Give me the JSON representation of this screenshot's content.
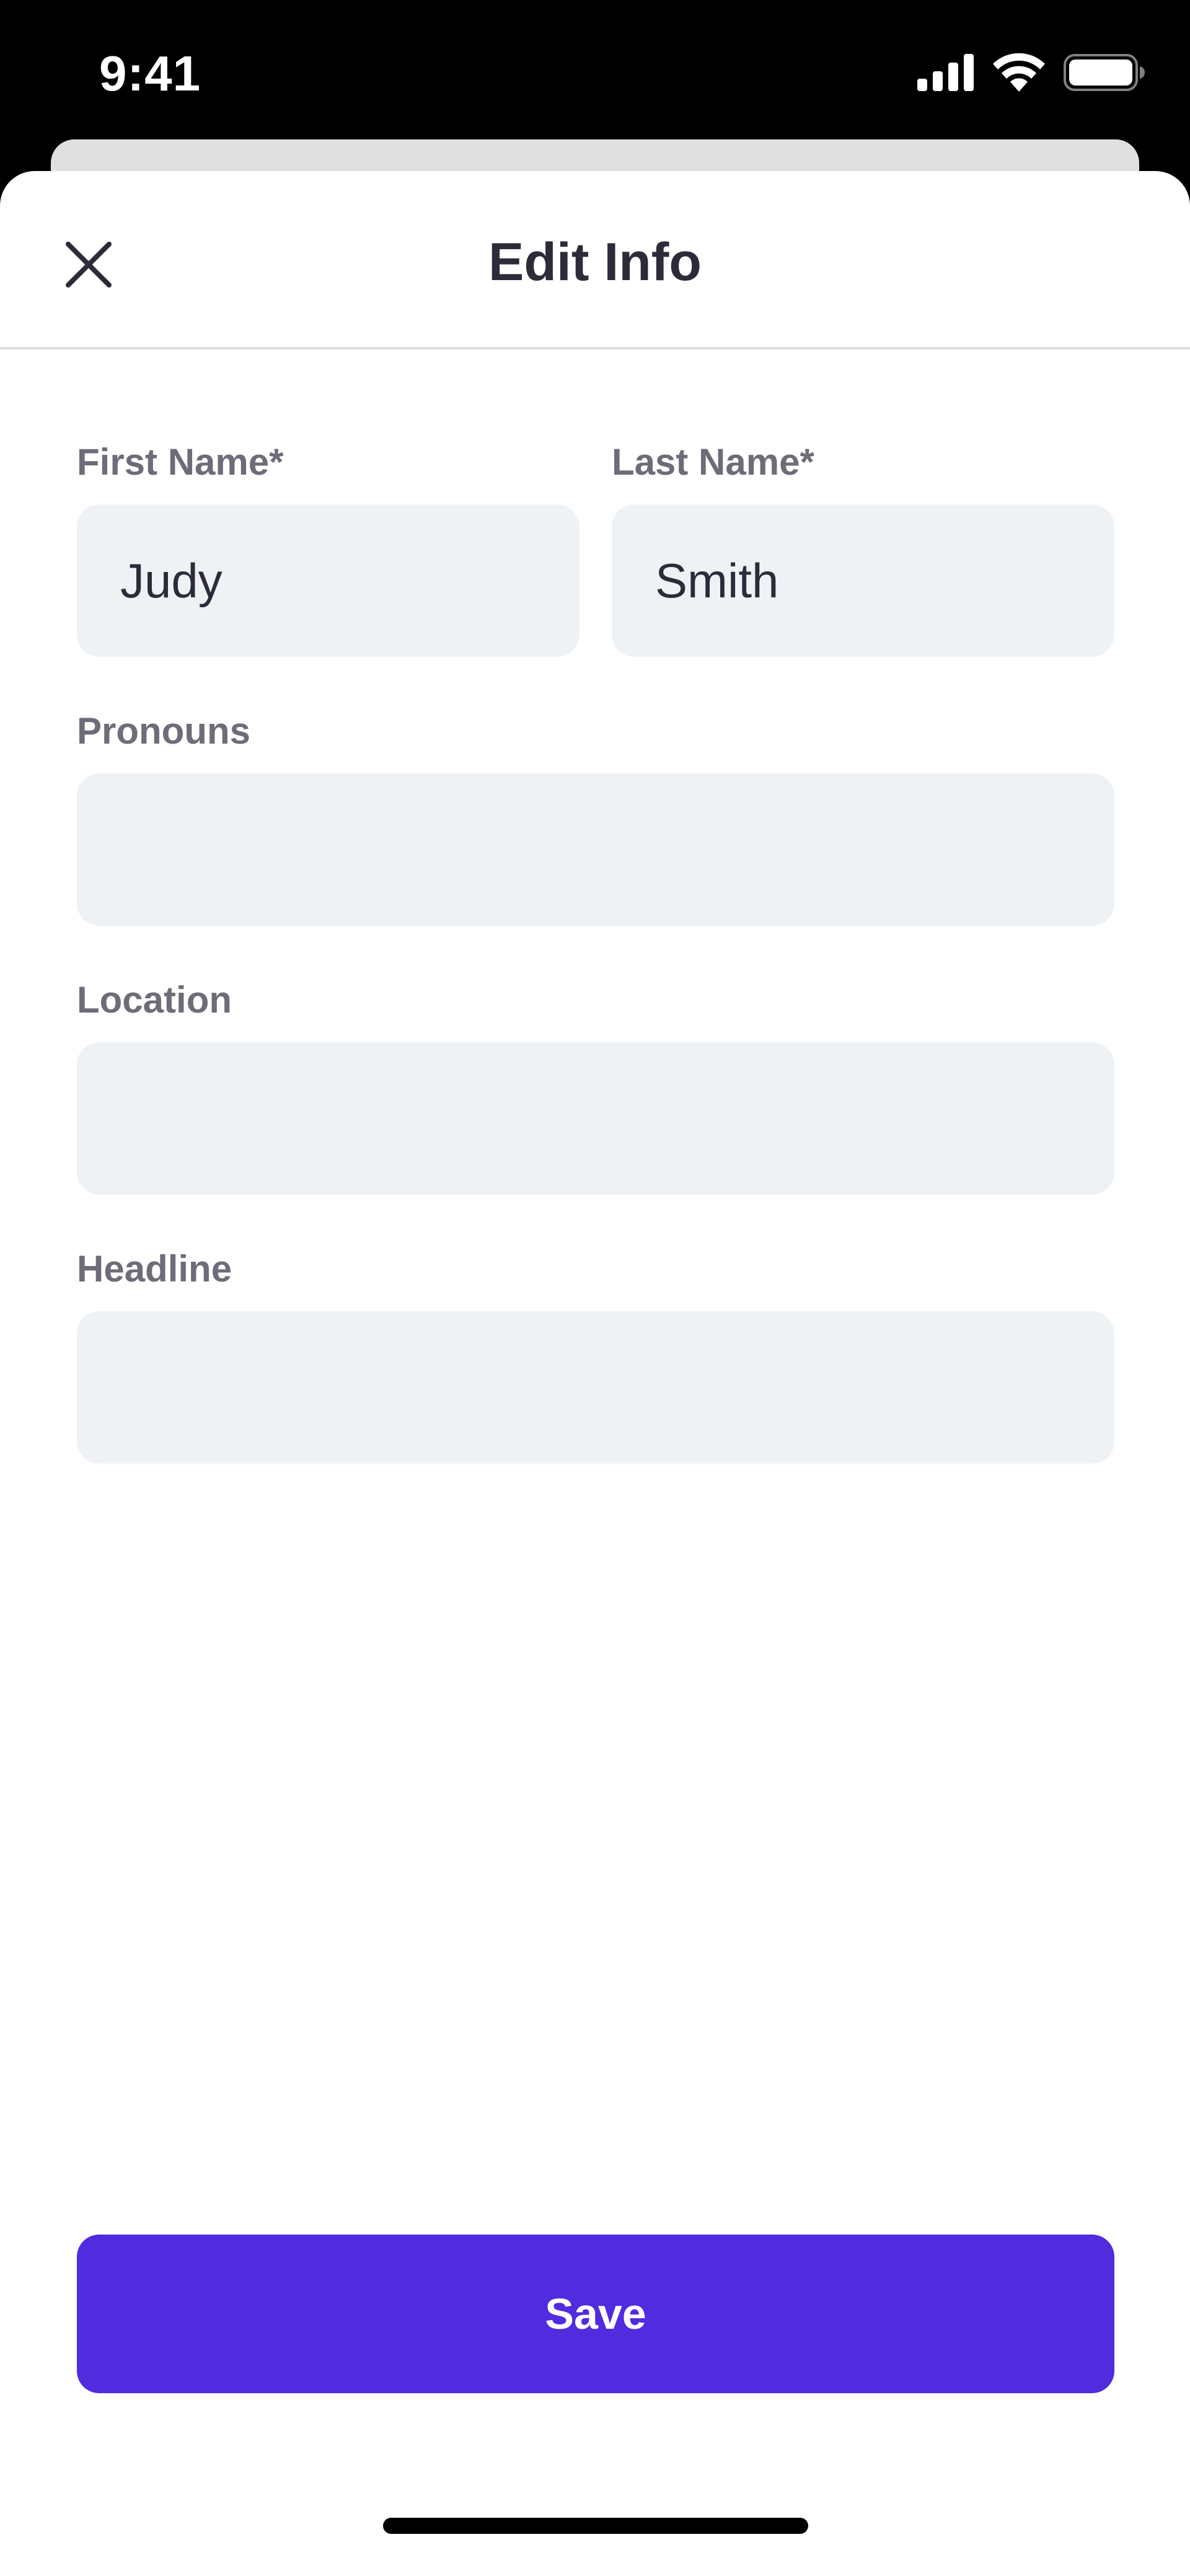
{
  "status_bar": {
    "time": "9:41",
    "icons": [
      "signal-icon",
      "wifi-icon",
      "battery-icon"
    ]
  },
  "header": {
    "title": "Edit Info",
    "close_icon": "close-icon"
  },
  "form": {
    "first_name": {
      "label": "First Name*",
      "value": "Judy"
    },
    "last_name": {
      "label": "Last Name*",
      "value": "Smith"
    },
    "pronouns": {
      "label": "Pronouns",
      "value": ""
    },
    "location": {
      "label": "Location",
      "value": ""
    },
    "headline": {
      "label": "Headline",
      "value": ""
    }
  },
  "actions": {
    "save_label": "Save"
  },
  "colors": {
    "accent": "#512bde",
    "input_bg": "#eff2f5",
    "label": "#6d6c78",
    "title": "#2d2b39"
  }
}
